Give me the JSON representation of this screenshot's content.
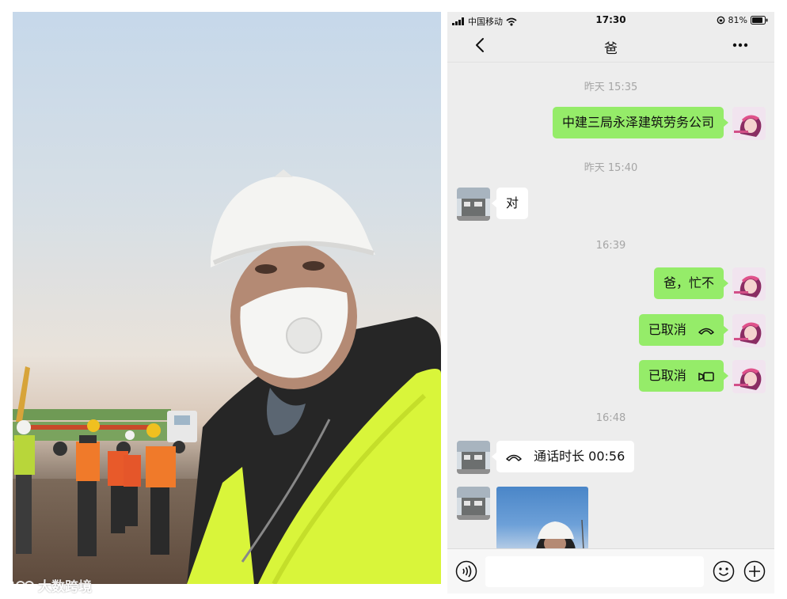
{
  "status_bar": {
    "carrier": "中国移动",
    "time": "17:30",
    "battery": "81%"
  },
  "nav": {
    "title": "爸"
  },
  "messages": [
    {
      "type": "timestamp",
      "text": "昨天 15:35"
    },
    {
      "type": "text",
      "from": "me",
      "text": "中建三局永泽建筑劳务公司"
    },
    {
      "type": "timestamp",
      "text": "昨天 15:40"
    },
    {
      "type": "text",
      "from": "them",
      "text": "对"
    },
    {
      "type": "timestamp",
      "text": "16:39"
    },
    {
      "type": "text",
      "from": "me",
      "text": "爸，忙不"
    },
    {
      "type": "call",
      "from": "me",
      "text": "已取消",
      "icon": "phone-hangup-icon"
    },
    {
      "type": "call",
      "from": "me",
      "text": "已取消",
      "icon": "video-call-icon"
    },
    {
      "type": "timestamp",
      "text": "16:48"
    },
    {
      "type": "call",
      "from": "them",
      "text": "通话时长 00:56",
      "icon": "phone-hangup-icon"
    },
    {
      "type": "image",
      "from": "them"
    }
  ],
  "input": {
    "value": "",
    "placeholder": ""
  },
  "watermark": {
    "text": "大数跨境"
  },
  "colors": {
    "chat_bg": "#ededed",
    "my_bubble": "#95ec69",
    "their_bubble": "#ffffff",
    "timestamp": "#a5a5a5",
    "vest": "#d9f53a",
    "helmet": "#f4f4f2"
  }
}
